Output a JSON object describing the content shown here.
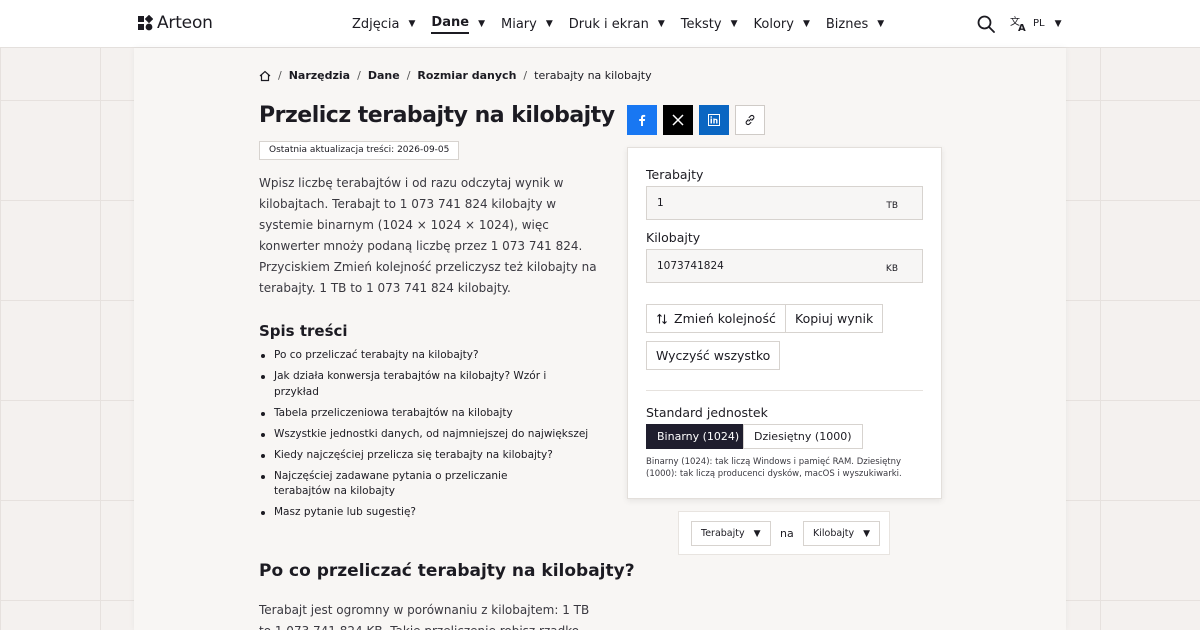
{
  "header": {
    "logo_text": "Arteon",
    "nav": [
      {
        "label": "Zdjęcia",
        "active": false
      },
      {
        "label": "Dane",
        "active": true
      },
      {
        "label": "Miary",
        "active": false
      },
      {
        "label": "Druk i ekran",
        "active": false
      },
      {
        "label": "Teksty",
        "active": false
      },
      {
        "label": "Kolory",
        "active": false
      },
      {
        "label": "Biznes",
        "active": false
      }
    ],
    "language": "PL",
    "caret": "▼"
  },
  "breadcrumb": {
    "items": [
      "Narzędzia",
      "Dane",
      "Rozmiar danych"
    ],
    "current": "terabajty na kilobajty",
    "separator": "/"
  },
  "page": {
    "title": "Przelicz terabajty na kilobajty",
    "updated": "Ostatnia aktualizacja treści: 2026-09-05",
    "intro": "Wpisz liczbę terabajtów i od razu odczytaj wynik w kilobajtach. Terabajt to 1 073 741 824 kilobajty w systemie binarnym (1024 × 1024 × 1024), więc konwerter mnoży podaną liczbę przez 1 073 741 824. Przyciskiem Zmień kolejność przeliczysz też kilobajty na terabajty. 1 TB to 1 073 741 824 kilobajty.",
    "toc_title": "Spis treści",
    "toc": [
      "Po co przeliczać terabajty na kilobajty?",
      "Jak działa konwersja terabajtów na kilobajty? Wzór i przykład",
      "Tabela przeliczeniowa terabajtów na kilobajty",
      "Wszystkie jednostki danych, od najmniejszej do największej",
      "Kiedy najczęściej przelicza się terabajty na kilobajty?",
      "Najczęściej zadawane pytania o przeliczanie terabajtów na kilobajty",
      "Masz pytanie lub sugestię?"
    ],
    "section_title": "Po co przeliczać terabajty na kilobajty?",
    "section_text": "Terabajt jest ogromny w porównaniu z kilobajtem: 1 TB to 1 073 741 824 KB. Takie przeliczenie robisz rzadko"
  },
  "converter": {
    "from_label": "Terabajty",
    "from_value": "1",
    "from_unit": "TB",
    "to_label": "Kilobajty",
    "to_value": "1073741824",
    "to_unit": "KB",
    "swap_button": "Zmień kolejność",
    "copy_button": "Kopiuj wynik",
    "clear_button": "Wyczyść wszystko",
    "standard_label": "Standard jednostek",
    "binary_option": "Binarny (1024)",
    "decimal_option": "Dziesiętny (1000)",
    "standard_note": "Binarny (1024): tak liczą Windows i pamięć RAM. Dziesiętny (1000): tak liczą producenci dysków, macOS i wyszukiwarki."
  },
  "unit_bar": {
    "from": "Terabajty",
    "connector": "na",
    "to": "Kilobajty"
  },
  "colors": {
    "accent_dark": "#1f1e2e",
    "facebook": "#1877f2",
    "x": "#000000",
    "linkedin": "#0a66c2"
  }
}
